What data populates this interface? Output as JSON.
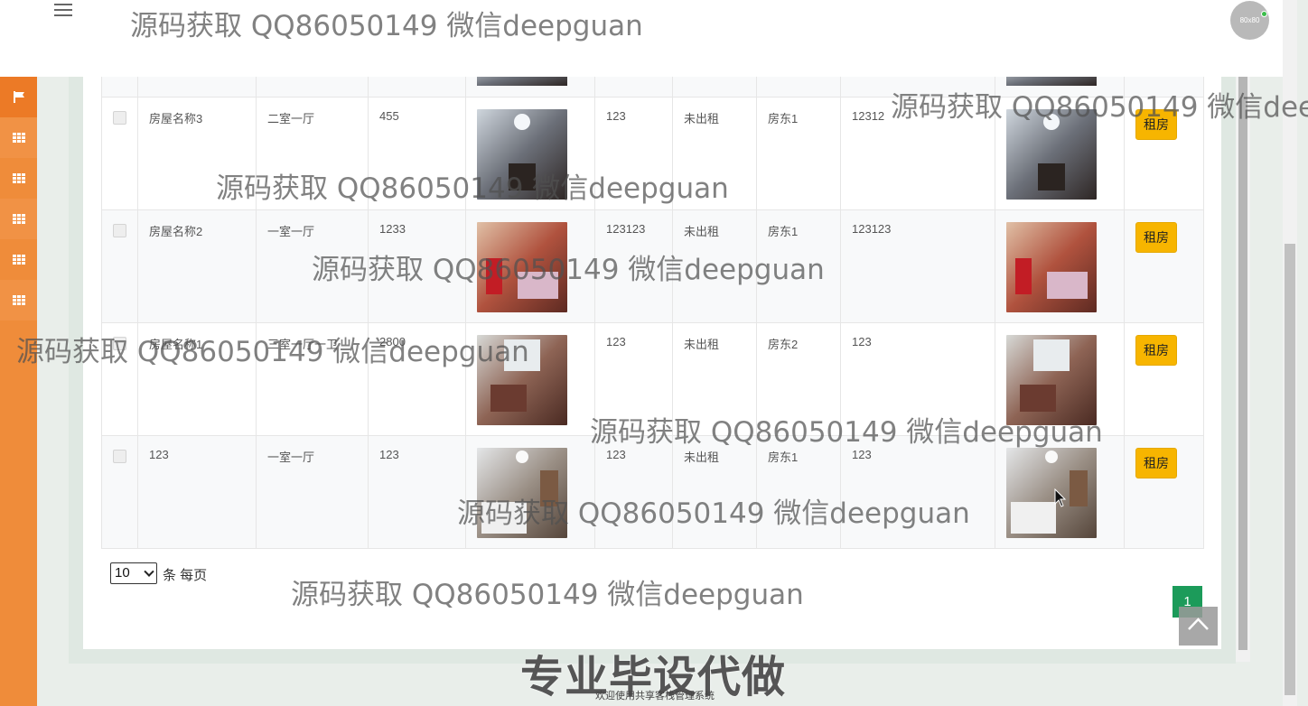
{
  "watermark": "源码获取 QQ86050149 微信deepguan",
  "avatar_text": "80x80",
  "table": {
    "rows": [
      {
        "name": "房屋名称3",
        "layout": "二室一厅",
        "area": "455",
        "img": "house-a",
        "price": "123",
        "status": "未出租",
        "landlord": "房东1",
        "phone": "12312",
        "img2": "house-a",
        "action": "租房"
      },
      {
        "name": "房屋名称2",
        "layout": "一室一厅",
        "area": "1233",
        "img": "house-b",
        "price": "123123",
        "status": "未出租",
        "landlord": "房东1",
        "phone": "123123",
        "img2": "house-b",
        "action": "租房"
      },
      {
        "name": "房屋名称1",
        "layout": "三室一厅一卫",
        "area": "2800",
        "img": "house-c",
        "price": "123",
        "status": "未出租",
        "landlord": "房东2",
        "phone": "123",
        "img2": "house-c",
        "action": "租房"
      },
      {
        "name": "123",
        "layout": "一室一厅",
        "area": "123",
        "img": "house-d",
        "price": "123",
        "status": "未出租",
        "landlord": "房东1",
        "phone": "123",
        "img2": "house-d",
        "action": "租房"
      }
    ]
  },
  "pager": {
    "per_page": "10",
    "per_page_label": "条 每页",
    "current_page": "1"
  },
  "footer": {
    "big": "专业毕设代做",
    "small": "欢迎使用共享客栈管理系统"
  },
  "icons": {
    "menu": "hamburger-icon",
    "sidebar_top": "flag-icon",
    "sidebar_rest": "grid-icon",
    "back_top": "chevron-up-icon"
  },
  "colors": {
    "sidebar": "#ef8c3a",
    "rent_button": "#f7b500",
    "page_active": "#1c9b5a"
  }
}
